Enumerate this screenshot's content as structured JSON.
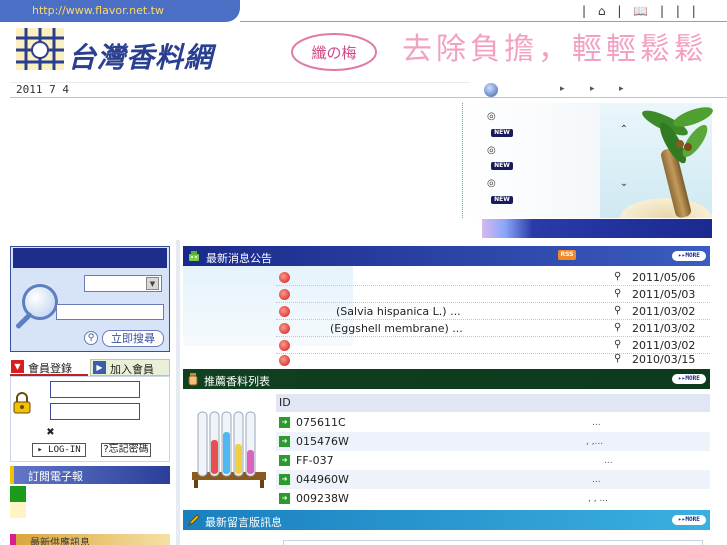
{
  "site": {
    "url": "http://www.flavor.net.tw",
    "name": "台灣香料網",
    "slogan": "去除負擔，輕輕鬆鬆",
    "badge": "纖の梅",
    "date": "2011 7 4"
  },
  "top_links": [
    "|",
    "⌂",
    "|",
    "📖",
    "|",
    "|",
    "|"
  ],
  "scroll_news": {
    "bullets": [
      "◎",
      "◎",
      "◎"
    ],
    "new_label": "NEW"
  },
  "search": {
    "go_label": "立即搜尋"
  },
  "login": {
    "tab_login": "會員登錄",
    "tab_join": "加入會員",
    "login_button": "▸ LOG-IN",
    "forgot_button": "?忘記密碼",
    "remember_mark": "✖"
  },
  "epaper": {
    "label": "訂閱電子報"
  },
  "partner": {
    "label": "最新供應訊息"
  },
  "sections": {
    "news": {
      "title": "最新消息公告",
      "more": "▸▸MORE",
      "rss": "RSS"
    },
    "products": {
      "title": "推薦香料列表",
      "more": "▸▸MORE",
      "id_header": "ID"
    },
    "messages": {
      "title": "最新留言版訊息",
      "more": "▸▸MORE"
    }
  },
  "news_items": [
    {
      "title": "",
      "date": "2011/05/06"
    },
    {
      "title": "",
      "date": "2011/05/03"
    },
    {
      "title": "(Salvia hispanica L.) ...",
      "date": "2011/03/02"
    },
    {
      "title": "(Eggshell membrane)   ...",
      "date": "2011/03/02"
    },
    {
      "title": "",
      "date": "2011/03/02"
    },
    {
      "title": "",
      "date": "2010/03/15"
    }
  ],
  "products": [
    {
      "id": "075611C",
      "tail": "..."
    },
    {
      "id": "015476W",
      "tail": ",  ,..."
    },
    {
      "id": "FF-037",
      "tail": "..."
    },
    {
      "id": "044960W",
      "tail": "..."
    },
    {
      "id": "009238W",
      "tail": ",  , ..."
    }
  ],
  "colors": {
    "brand_blue": "#2a3f8f",
    "news_header": "#1a2a8a",
    "products_header": "#0f4020",
    "messages_header": "#1a7fbf",
    "bullet_red": "#d01818"
  }
}
